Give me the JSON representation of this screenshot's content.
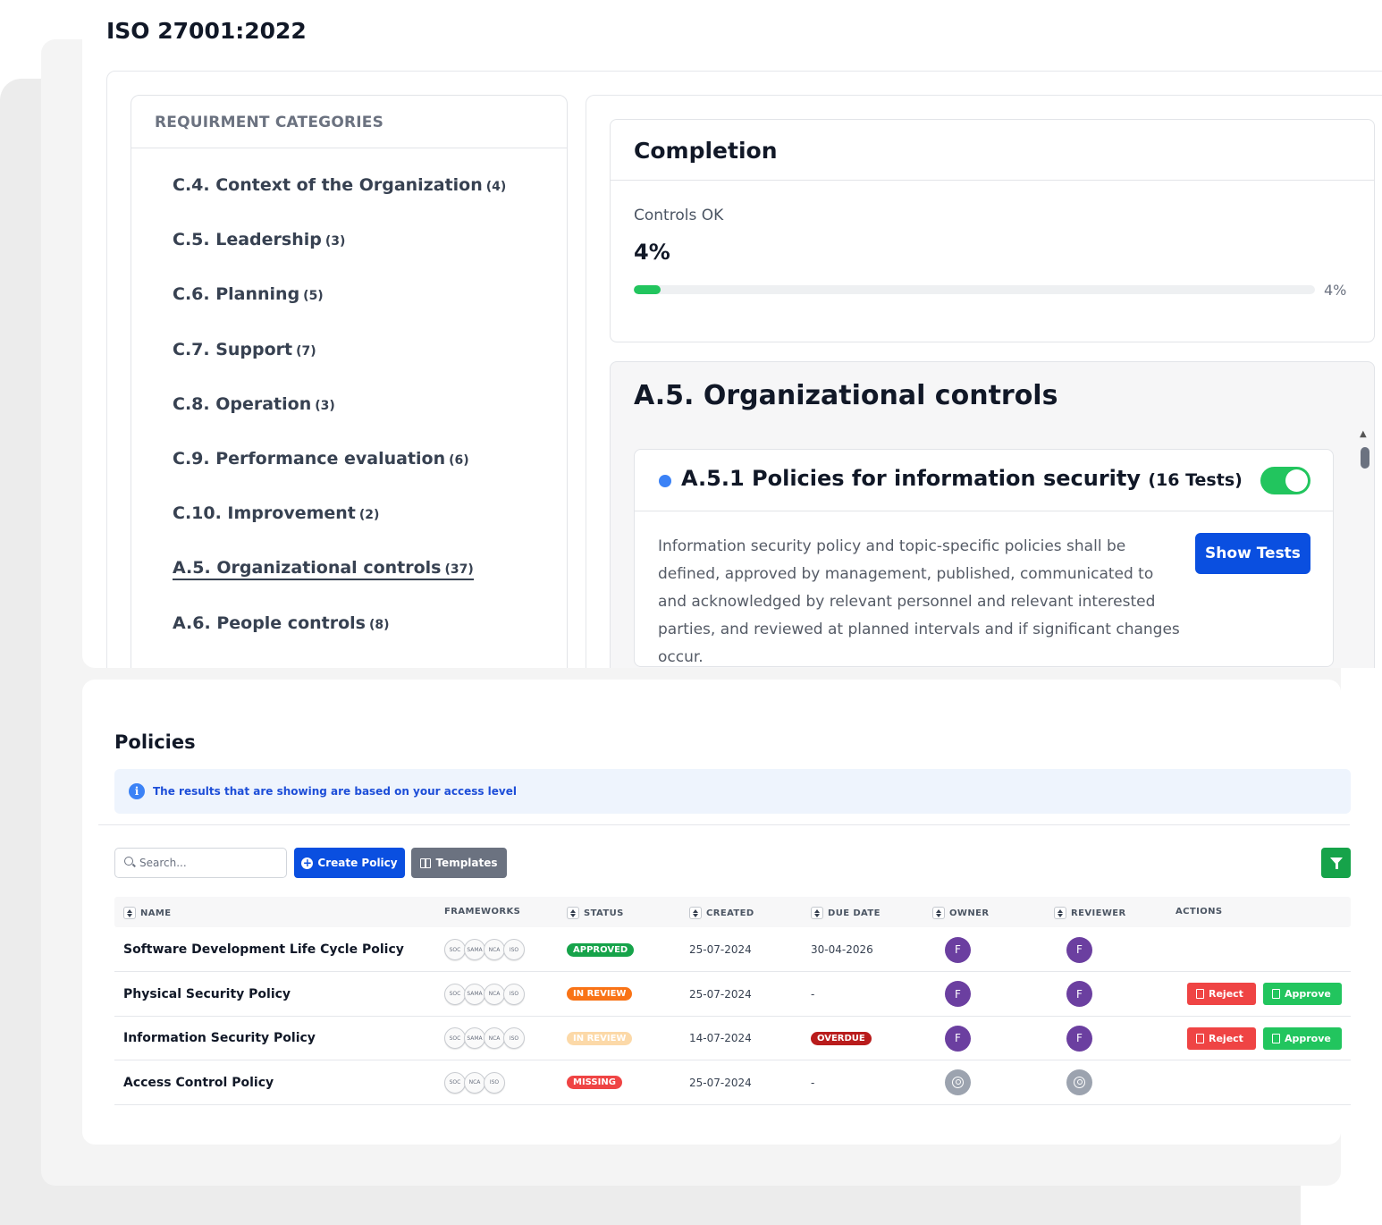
{
  "page_title": "ISO 27001:2022",
  "categories": {
    "header": "REQUIRMENT CATEGORIES",
    "items": [
      {
        "label": "C.4. Context of the Organization",
        "count": "(4)"
      },
      {
        "label": "C.5. Leadership",
        "count": "(3)"
      },
      {
        "label": "C.6. Planning",
        "count": "(5)"
      },
      {
        "label": "C.7. Support",
        "count": "(7)"
      },
      {
        "label": "C.8. Operation",
        "count": "(3)"
      },
      {
        "label": "C.9. Performance evaluation",
        "count": "(6)"
      },
      {
        "label": "C.10. Improvement",
        "count": "(2)"
      },
      {
        "label": "A.5. Organizational controls",
        "count": "(37)",
        "active": true
      },
      {
        "label": "A.6. People controls",
        "count": "(8)"
      }
    ]
  },
  "completion": {
    "title": "Completion",
    "label": "Controls OK",
    "value": "4%",
    "progress_pct": 4,
    "progress_label": "4%",
    "fill_color": "#22c55e"
  },
  "section": {
    "title": "A.5. Organizational controls",
    "control": {
      "title": "A.5.1 Policies for information security",
      "tests": "(16 Tests)",
      "enabled": true,
      "description": "Information security policy and topic-specific policies shall be defined, approved by management, published, communicated to and acknowledged by relevant personnel and relevant interested parties, and reviewed at planned intervals and if significant changes occur.",
      "show_tests_label": "Show Tests"
    }
  },
  "policies": {
    "title": "Policies",
    "info_text": "The results that are showing are based on your access level",
    "search": {
      "placeholder": "Search...",
      "value": ""
    },
    "create_label": "Create Policy",
    "templates_label": "Templates",
    "columns": [
      "NAME",
      "FRAMEWORKS",
      "STATUS",
      "CREATED",
      "DUE DATE",
      "OWNER",
      "REVIEWER",
      "ACTIONS"
    ],
    "rows": [
      {
        "name": "Software Development Life Cycle Policy",
        "frameworks": [
          "SOC",
          "SAMA",
          "NCA",
          "ISO"
        ],
        "status": "APPROVED",
        "status_color": "#16a34a",
        "created": "25-07-2024",
        "due": "30-04-2026",
        "due_badge": "",
        "owner": "F",
        "reviewer": "F",
        "actions": []
      },
      {
        "name": "Physical Security Policy",
        "frameworks": [
          "SOC",
          "SAMA",
          "NCA",
          "ISO"
        ],
        "status": "IN REVIEW",
        "status_color": "#f97316",
        "created": "25-07-2024",
        "due": "-",
        "due_badge": "",
        "owner": "F",
        "reviewer": "F",
        "actions": [
          "Reject",
          "Approve"
        ]
      },
      {
        "name": "Information Security Policy",
        "frameworks": [
          "SOC",
          "SAMA",
          "NCA",
          "ISO"
        ],
        "status": "IN REVIEW",
        "status_color": "#fcd9a8",
        "created": "14-07-2024",
        "due": "",
        "due_badge": "OVERDUE",
        "owner": "F",
        "reviewer": "F",
        "actions": [
          "Reject",
          "Approve"
        ]
      },
      {
        "name": "Access Control Policy",
        "frameworks": [
          "SOC",
          "NCA",
          "ISO"
        ],
        "status": "MISSING",
        "status_color": "#ef4444",
        "created": "25-07-2024",
        "due": "-",
        "due_badge": "",
        "owner": "",
        "reviewer": "",
        "actions": []
      }
    ]
  }
}
